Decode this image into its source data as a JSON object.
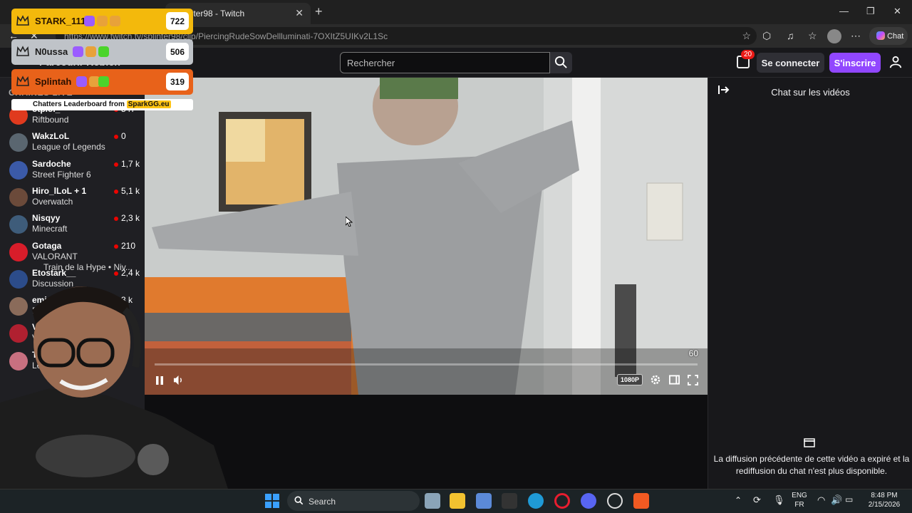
{
  "browser": {
    "tab_title": "inter98 - Twitch",
    "url": "https://www.twitch.tv/splinter98/clip/PiercingRudeSowDellluminati-7OXItZ5UIKv2L1Sc",
    "copilot_label": "Chat"
  },
  "twitch_nav": {
    "links": "Parcourir    Roblox",
    "search_placeholder": "Rechercher",
    "notif_count": "20",
    "login_label": "Se connecter",
    "signup_label": "S'inscrire"
  },
  "sidebar": {
    "header": "CHAÎNES LIVE",
    "hype_line": "Train de la Hype • Niv...",
    "channels": [
      {
        "name": "otplol_",
        "game": "Riftbound",
        "viewers": "547",
        "avatar_color": "#e03a1e"
      },
      {
        "name": "WakzLoL",
        "game": "League of Legends",
        "viewers": "0",
        "avatar_color": "#5a6670"
      },
      {
        "name": "Sardoche",
        "game": "Street Fighter 6",
        "viewers": "1,7 k",
        "avatar_color": "#3b5aa8"
      },
      {
        "name": "Hiro_lLoL + 1",
        "game": "Overwatch",
        "viewers": "5,1 k",
        "avatar_color": "#6b4a3a"
      },
      {
        "name": "Nisqyy",
        "game": "Minecraft",
        "viewers": "2,3 k",
        "avatar_color": "#3e5c7a"
      },
      {
        "name": "Gotaga",
        "game": "VALORANT",
        "viewers": "210",
        "avatar_color": "#d81d2a"
      },
      {
        "name": "Etostark__",
        "game": "Discussion",
        "viewers": "2,4 k",
        "avatar_color": "#2c4c8a"
      },
      {
        "name": "emi",
        "game": "D",
        "viewers": "3 k",
        "avatar_color": "#8a6b5a"
      },
      {
        "name": "VA",
        "game": "V",
        "viewers": "",
        "avatar_color": "#b02030"
      },
      {
        "name": "T",
        "game": "Le",
        "viewers": "k",
        "avatar_color": "#c87080"
      }
    ]
  },
  "player": {
    "fps": "60",
    "quality": "1080P",
    "progress": 0.0
  },
  "chat": {
    "title": "Chat sur les vidéos",
    "message": "La diffusion précédente de cette vidéo a expiré et la rediffusion du chat n'est plus disponible."
  },
  "leaderboard": {
    "rows": [
      {
        "name": "STARK_111",
        "score": "722",
        "bg": "#f3b90c",
        "name_color": "#2b1600"
      },
      {
        "name": "N0ussa",
        "score": "506",
        "bg": "#bfc3c8",
        "name_color": "#1a1a1a"
      },
      {
        "name": "Splintah",
        "score": "319",
        "bg": "#e8621a",
        "name_color": "#2b1000"
      }
    ],
    "footer_text": "Chatters Leaderboard from ",
    "footer_brand": "SparkGG.eu"
  },
  "taskbar": {
    "search_label": "Search",
    "lang_top": "ENG",
    "lang_bottom": "FR",
    "time": "8:48 PM",
    "date": "2/15/2026"
  }
}
